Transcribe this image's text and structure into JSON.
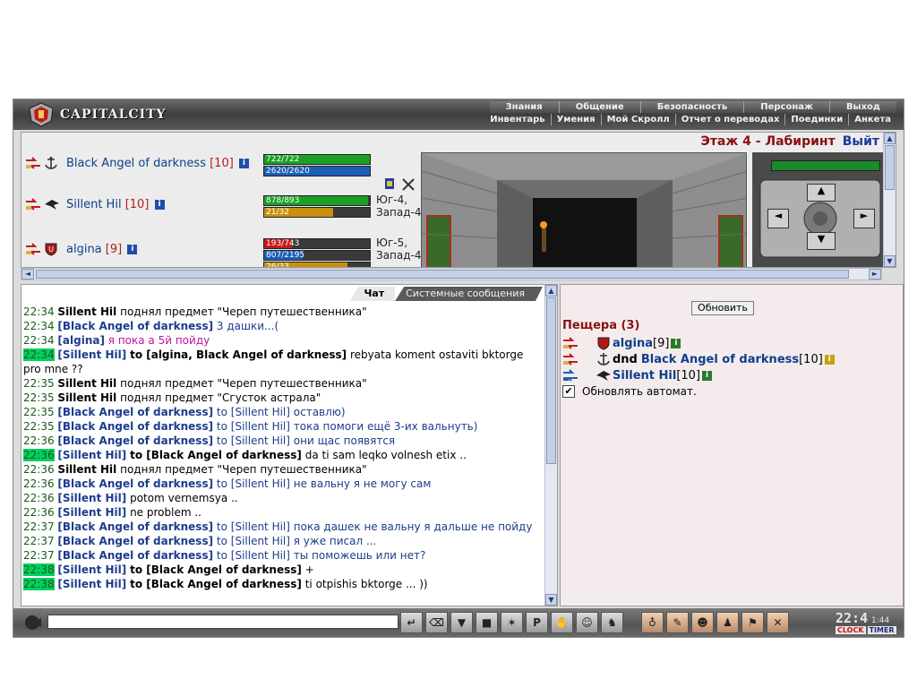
{
  "header": {
    "logo_text": "CAPITALCITY",
    "menu_top": [
      "Знания",
      "Общение",
      "Безопасность",
      "Персонаж",
      "Выход"
    ],
    "menu_bottom": [
      "Инвентарь",
      "Умения",
      "Мой Скролл",
      "Отчет о переводах",
      "Поединки",
      "Анкета"
    ]
  },
  "location": {
    "name": "Этаж 4 - Лабиринт",
    "exit_label": "Выйт"
  },
  "players": [
    {
      "name": "Black Angel of darkness",
      "level": "[10]",
      "bars": [
        {
          "text": "722/722",
          "fraction": 1.0,
          "color": "#1aa024"
        },
        {
          "text": "2620/2620",
          "fraction": 1.0,
          "color": "#1c5eb4"
        }
      ]
    },
    {
      "name": "Sillent Hil",
      "level": "[10]",
      "bars": [
        {
          "text": "878/893",
          "fraction": 0.983,
          "color": "#1aa024"
        },
        {
          "text": "21/32",
          "fraction": 0.656,
          "color": "#c8900c"
        }
      ],
      "coords": "Юг-4, Запад-4"
    },
    {
      "name": "algina",
      "level": "[9]",
      "bars": [
        {
          "text": "193/743",
          "fraction": 0.26,
          "color": "#c41a1a"
        },
        {
          "text": "807/2195",
          "fraction": 0.368,
          "color": "#1c5eb4"
        },
        {
          "text": "26/33",
          "fraction": 0.788,
          "color": "#c8900c"
        }
      ],
      "coords": "Юг-5, Запад-4"
    }
  ],
  "chat": {
    "tab_active": "Чат",
    "tab_inactive": "Системные сообщения",
    "messages": [
      {
        "time": "22:34",
        "hl": false,
        "from": "Sillent Hil",
        "from_style": "bold",
        "to": "",
        "text": "поднял предмет \"Череп путешественника\"",
        "color": "black"
      },
      {
        "time": "22:34",
        "hl": false,
        "from": "[Black Angel of darkness]",
        "from_style": "bold-blue",
        "to": "",
        "text": "3 дашки...(",
        "color": "blue"
      },
      {
        "time": "22:34",
        "hl": false,
        "from": "[algina]",
        "from_style": "bold-blue",
        "to": "",
        "text": "я пока а 5й пойду",
        "color": "magenta"
      },
      {
        "time": "22:34",
        "hl": true,
        "from": "[Sillent Hil]",
        "from_style": "bold-blue",
        "to": "to [algina, Black Angel of darkness]",
        "text": "rebyata koment ostaviti bktorge pro mne ??",
        "color": "black"
      },
      {
        "time": "22:35",
        "hl": false,
        "from": "Sillent Hil",
        "from_style": "bold",
        "to": "",
        "text": "поднял предмет \"Череп путешественника\"",
        "color": "black"
      },
      {
        "time": "22:35",
        "hl": false,
        "from": "Sillent Hil",
        "from_style": "bold",
        "to": "",
        "text": "поднял предмет \"Сгусток астрала\"",
        "color": "black"
      },
      {
        "time": "22:35",
        "hl": false,
        "from": "[Black Angel of darkness]",
        "from_style": "bold-blue",
        "to": "",
        "text": "to [Sillent Hil] оставлю)",
        "color": "blue"
      },
      {
        "time": "22:35",
        "hl": false,
        "from": "[Black Angel of darkness]",
        "from_style": "bold-blue",
        "to": "",
        "text": "to [Sillent Hil] тока помоги ещё 3-их вальнуть)",
        "color": "blue"
      },
      {
        "time": "22:36",
        "hl": false,
        "from": "[Black Angel of darkness]",
        "from_style": "bold-blue",
        "to": "",
        "text": "to [Sillent Hil] они щас появятся",
        "color": "blue"
      },
      {
        "time": "22:36",
        "hl": true,
        "from": "[Sillent Hil]",
        "from_style": "bold-blue",
        "to": "to [Black Angel of darkness]",
        "text": "da ti sam leqko volnesh etix ..",
        "color": "black"
      },
      {
        "time": "22:36",
        "hl": false,
        "from": "Sillent Hil",
        "from_style": "bold",
        "to": "",
        "text": "поднял предмет \"Череп путешественника\"",
        "color": "black"
      },
      {
        "time": "22:36",
        "hl": false,
        "from": "[Black Angel of darkness]",
        "from_style": "bold-blue",
        "to": "",
        "text": "to [Sillent Hil] не вальну я не могу сам",
        "color": "blue"
      },
      {
        "time": "22:36",
        "hl": false,
        "from": "[Sillent Hil]",
        "from_style": "bold-blue",
        "to": "",
        "text": "potom vernemsya ..",
        "color": "black"
      },
      {
        "time": "22:36",
        "hl": false,
        "from": "[Sillent Hil]",
        "from_style": "bold-blue",
        "to": "",
        "text": "ne problem ..",
        "color": "black"
      },
      {
        "time": "22:37",
        "hl": false,
        "from": "[Black Angel of darkness]",
        "from_style": "bold-blue",
        "to": "",
        "text": "to [Sillent Hil] пока дашек не вальну я дальше не пойду",
        "color": "blue"
      },
      {
        "time": "22:37",
        "hl": false,
        "from": "[Black Angel of darkness]",
        "from_style": "bold-blue",
        "to": "",
        "text": "to [Sillent Hil] я уже писал ...",
        "color": "blue"
      },
      {
        "time": "22:37",
        "hl": false,
        "from": "[Black Angel of darkness]",
        "from_style": "bold-blue",
        "to": "",
        "text": "to [Sillent Hil] ты поможешь или нет?",
        "color": "blue"
      },
      {
        "time": "22:38",
        "hl": true,
        "from": "[Sillent Hil]",
        "from_style": "bold-blue",
        "to": "to [Black Angel of darkness]",
        "text": "+",
        "color": "black"
      },
      {
        "time": "22:38",
        "hl": true,
        "from": "[Sillent Hil]",
        "from_style": "bold-blue",
        "to": "to [Black Angel of darkness]",
        "text": "ti otpishis bktorge ... ))",
        "color": "black"
      }
    ],
    "input_value": ""
  },
  "room": {
    "refresh_label": "Обновить",
    "title": "Пещера (3)",
    "members": [
      {
        "dnd": "",
        "name": "algina",
        "level": "[9]"
      },
      {
        "dnd": "dnd",
        "name": "Black Angel of darkness",
        "level": "[10]"
      },
      {
        "dnd": "",
        "name": "Sillent Hil",
        "level": "[10]"
      }
    ],
    "auto_refresh_label": "Обновлять автомат.",
    "auto_refresh_checked": true
  },
  "clock": {
    "time": "22:4",
    "sec": "1:44",
    "label_clock": "CLOCK",
    "label_timer": "TIMER"
  },
  "icons": {
    "toolbar": [
      "enter-icon",
      "eraser-icon",
      "filter-icon",
      "save-icon",
      "dance-icon",
      "pl-icon",
      "gesture-icon",
      "smile-icon",
      "helmet-icon",
      "separator",
      "potion-icon",
      "map-icon",
      "mask-icon",
      "character-icon",
      "flag-icon",
      "exit-icon"
    ]
  }
}
